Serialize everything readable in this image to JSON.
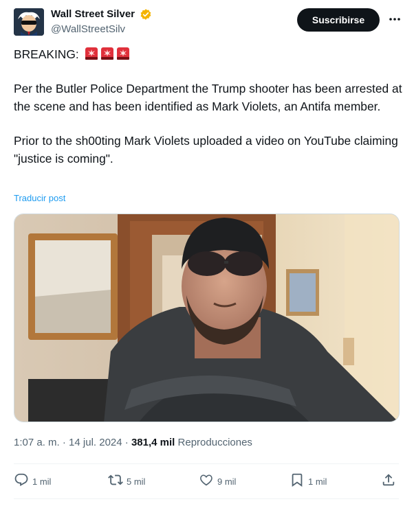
{
  "author": {
    "name": "Wall Street Silver",
    "handle": "@WallStreetSilv",
    "verified_color": "#f4b400"
  },
  "subscribe_label": "Suscribirse",
  "more_icon": "ellipsis-icon",
  "post": {
    "breaking": "BREAKING:",
    "paragraph1": "Per the Butler Police Department the Trump shooter has been arrested at the scene and has been identified as Mark Violets, an Antifa member.",
    "paragraph2": "Prior to the sh00ting Mark Violets uploaded a video on YouTube claiming \"justice is coming\".",
    "translate": "Traducir post"
  },
  "meta": {
    "time": "1:07 a. m.",
    "sep1": "·",
    "date": "14 jul. 2024",
    "sep2": "·",
    "views_count": "381,4 mil",
    "views_label": "Reproducciones"
  },
  "actions": {
    "replies": "1 mil",
    "reposts": "5 mil",
    "likes": "9 mil",
    "bookmarks": "1 mil"
  },
  "colors": {
    "accent": "#1d9bf0",
    "text": "#0f1419",
    "muted": "#536471",
    "siren": "#e0303b"
  }
}
